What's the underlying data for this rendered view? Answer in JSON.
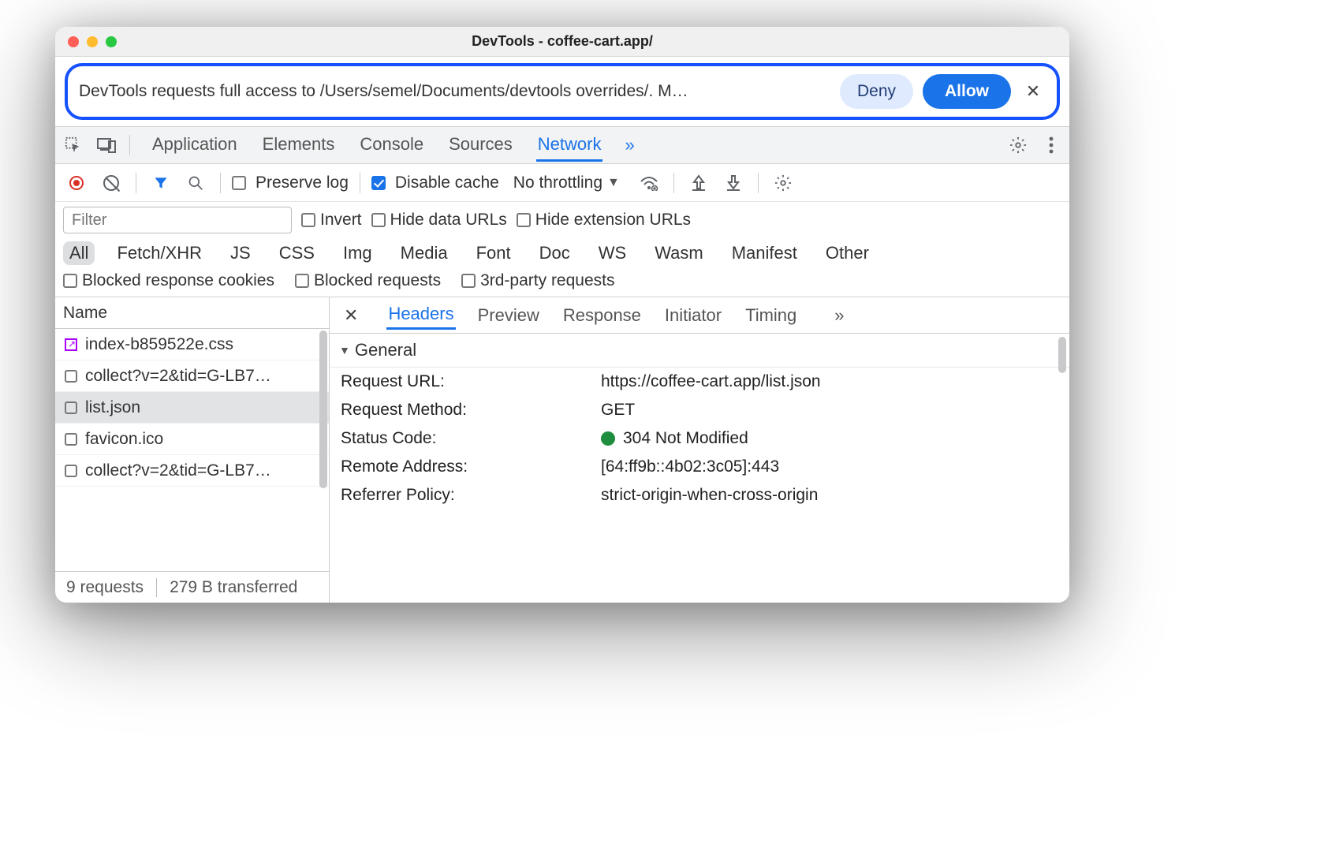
{
  "title": "DevTools - coffee-cart.app/",
  "banner": {
    "text": "DevTools requests full access to /Users/semel/Documents/devtools overrides/. M…",
    "deny": "Deny",
    "allow": "Allow"
  },
  "tabs": {
    "items": [
      {
        "label": "Application"
      },
      {
        "label": "Elements"
      },
      {
        "label": "Console"
      },
      {
        "label": "Sources"
      },
      {
        "label": "Network",
        "active": true
      }
    ]
  },
  "toolbar": {
    "preserve": "Preserve log",
    "disable_cache": "Disable cache",
    "throttling": "No throttling"
  },
  "filter": {
    "placeholder": "Filter",
    "invert": "Invert",
    "hide_data": "Hide data URLs",
    "hide_ext": "Hide extension URLs"
  },
  "types": [
    "All",
    "Fetch/XHR",
    "JS",
    "CSS",
    "Img",
    "Media",
    "Font",
    "Doc",
    "WS",
    "Wasm",
    "Manifest",
    "Other"
  ],
  "extra_filters": {
    "blocked_cookies": "Blocked response cookies",
    "blocked_requests": "Blocked requests",
    "third_party": "3rd-party requests"
  },
  "list": {
    "header": "Name",
    "items": [
      {
        "label": "index-b859522e.css",
        "icon": "override"
      },
      {
        "label": "collect?v=2&tid=G-LB7…",
        "icon": "box"
      },
      {
        "label": "list.json",
        "icon": "box",
        "selected": true
      },
      {
        "label": "favicon.ico",
        "icon": "box"
      },
      {
        "label": "collect?v=2&tid=G-LB7…",
        "icon": "box"
      }
    ]
  },
  "status": {
    "requests": "9 requests",
    "transferred": "279 B transferred"
  },
  "detail_tabs": [
    "Headers",
    "Preview",
    "Response",
    "Initiator",
    "Timing"
  ],
  "general": {
    "title": "General",
    "rows": [
      {
        "k": "Request URL:",
        "v": "https://coffee-cart.app/list.json"
      },
      {
        "k": "Request Method:",
        "v": "GET"
      },
      {
        "k": "Status Code:",
        "v": "304 Not Modified",
        "dot": true
      },
      {
        "k": "Remote Address:",
        "v": "[64:ff9b::4b02:3c05]:443"
      },
      {
        "k": "Referrer Policy:",
        "v": "strict-origin-when-cross-origin"
      }
    ]
  }
}
